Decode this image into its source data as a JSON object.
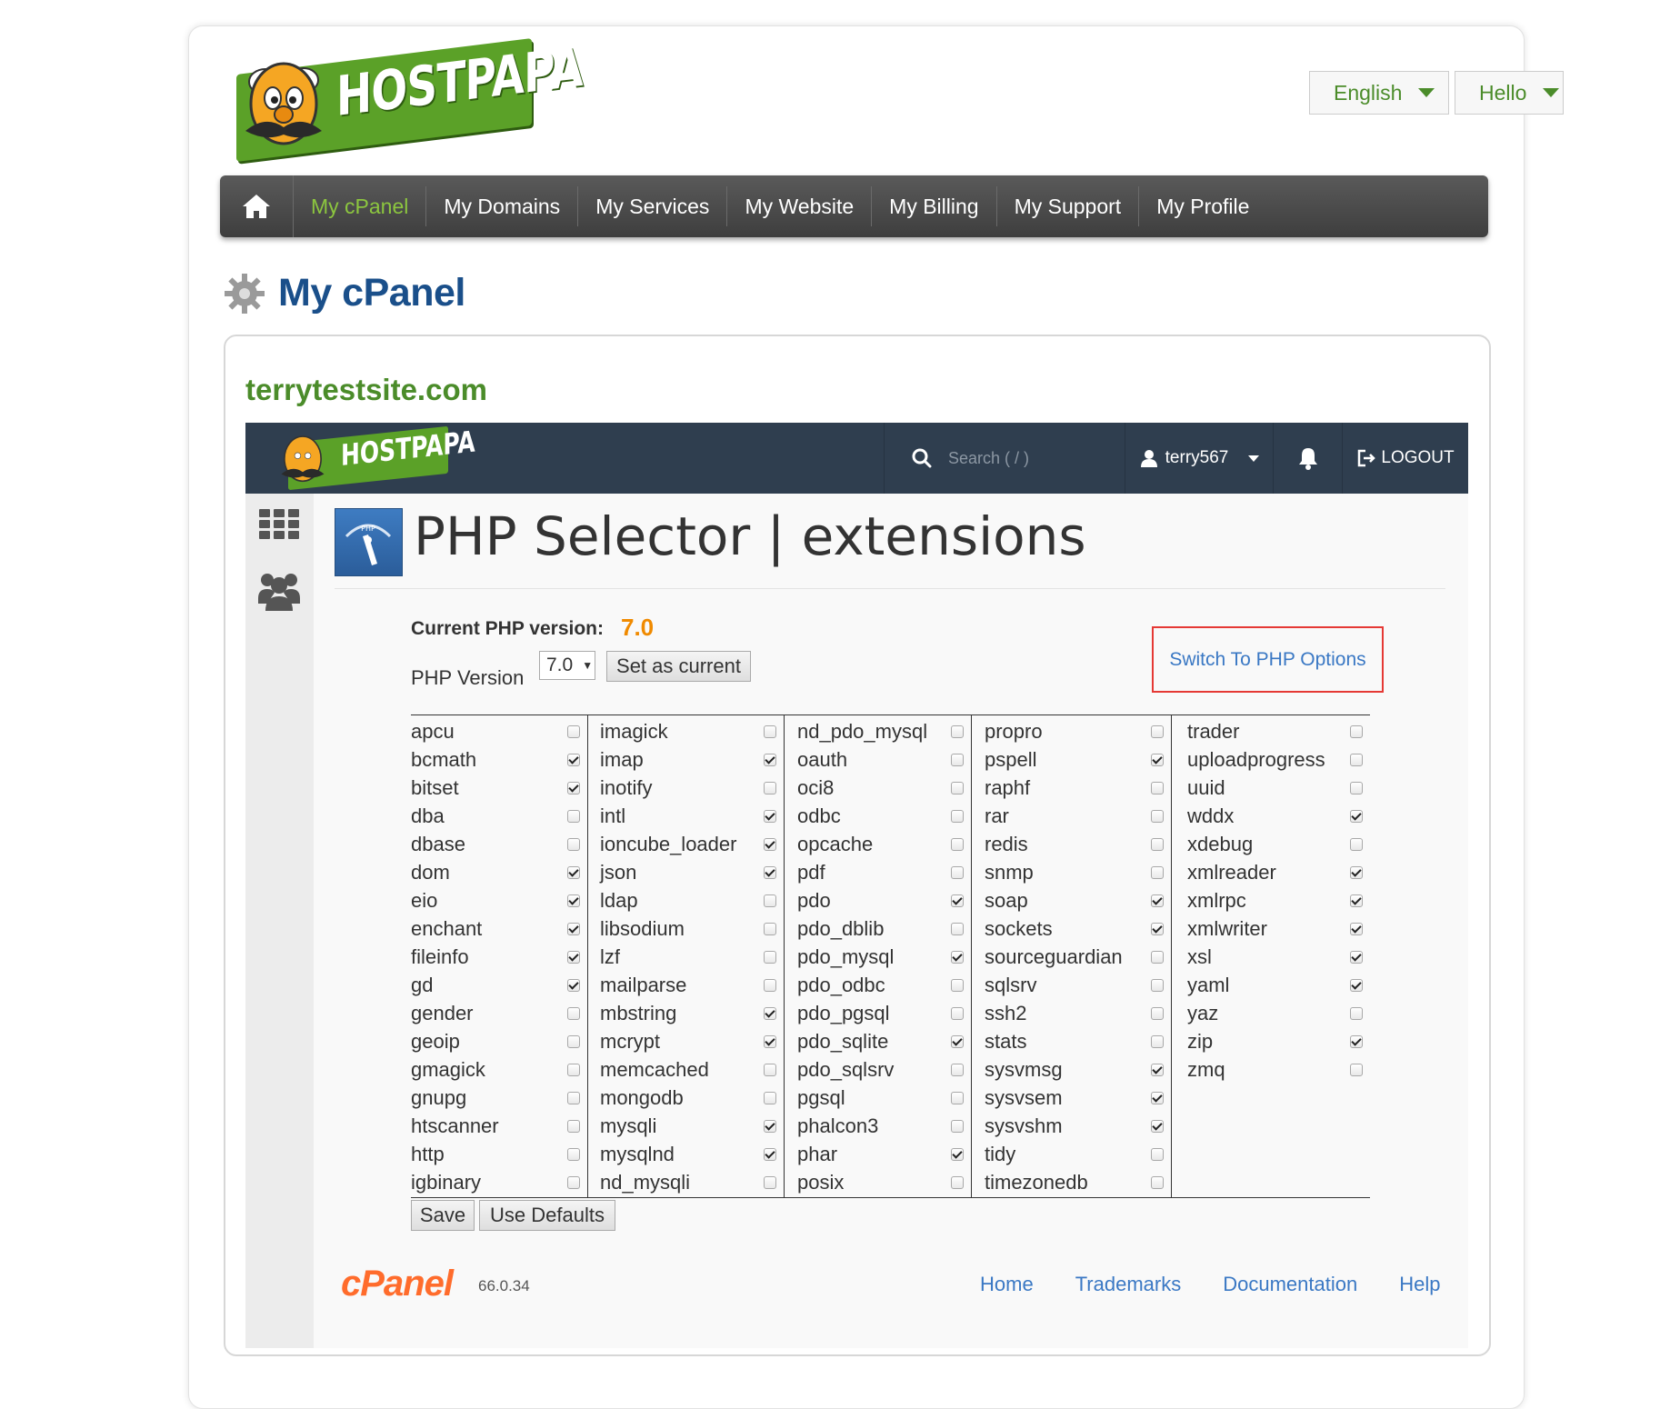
{
  "brand": {
    "logo_text": "HOSTPAPA"
  },
  "top_buttons": {
    "language": "English",
    "hello": "Hello"
  },
  "nav": {
    "items": [
      "My cPanel",
      "My Domains",
      "My Services",
      "My Website",
      "My Billing",
      "My Support",
      "My Profile"
    ],
    "active": "My cPanel"
  },
  "page_title": "My cPanel",
  "site_name": "terrytestsite.com",
  "cpanel": {
    "logo_text": "HOSTPAPA",
    "search_placeholder": "Search ( / )",
    "username": "terry567",
    "logout": "LOGOUT"
  },
  "php_selector": {
    "title": "PHP Selector | extensions",
    "icon_label": "PHP",
    "current_label": "Current PHP version:",
    "current_value": "7.0",
    "version_label": "PHP Version",
    "version_selected": "7.0",
    "set_current": "Set as current",
    "switch_link": "Switch To PHP Options",
    "save": "Save",
    "use_defaults": "Use Defaults"
  },
  "extensions": [
    [
      {
        "name": "apcu",
        "checked": false
      },
      {
        "name": "bcmath",
        "checked": true
      },
      {
        "name": "bitset",
        "checked": true
      },
      {
        "name": "dba",
        "checked": false
      },
      {
        "name": "dbase",
        "checked": false
      },
      {
        "name": "dom",
        "checked": true
      },
      {
        "name": "eio",
        "checked": true
      },
      {
        "name": "enchant",
        "checked": true
      },
      {
        "name": "fileinfo",
        "checked": true
      },
      {
        "name": "gd",
        "checked": true
      },
      {
        "name": "gender",
        "checked": false
      },
      {
        "name": "geoip",
        "checked": false
      },
      {
        "name": "gmagick",
        "checked": false
      },
      {
        "name": "gnupg",
        "checked": false
      },
      {
        "name": "htscanner",
        "checked": false
      },
      {
        "name": "http",
        "checked": false
      },
      {
        "name": "igbinary",
        "checked": false
      }
    ],
    [
      {
        "name": "imagick",
        "checked": false
      },
      {
        "name": "imap",
        "checked": true
      },
      {
        "name": "inotify",
        "checked": false
      },
      {
        "name": "intl",
        "checked": true
      },
      {
        "name": "ioncube_loader",
        "checked": true
      },
      {
        "name": "json",
        "checked": true
      },
      {
        "name": "ldap",
        "checked": false
      },
      {
        "name": "libsodium",
        "checked": false
      },
      {
        "name": "lzf",
        "checked": false
      },
      {
        "name": "mailparse",
        "checked": false
      },
      {
        "name": "mbstring",
        "checked": true
      },
      {
        "name": "mcrypt",
        "checked": true
      },
      {
        "name": "memcached",
        "checked": false
      },
      {
        "name": "mongodb",
        "checked": false
      },
      {
        "name": "mysqli",
        "checked": true
      },
      {
        "name": "mysqlnd",
        "checked": true
      },
      {
        "name": "nd_mysqli",
        "checked": false
      }
    ],
    [
      {
        "name": "nd_pdo_mysql",
        "checked": false
      },
      {
        "name": "oauth",
        "checked": false
      },
      {
        "name": "oci8",
        "checked": false
      },
      {
        "name": "odbc",
        "checked": false
      },
      {
        "name": "opcache",
        "checked": false
      },
      {
        "name": "pdf",
        "checked": false
      },
      {
        "name": "pdo",
        "checked": true
      },
      {
        "name": "pdo_dblib",
        "checked": false
      },
      {
        "name": "pdo_mysql",
        "checked": true
      },
      {
        "name": "pdo_odbc",
        "checked": false
      },
      {
        "name": "pdo_pgsql",
        "checked": false
      },
      {
        "name": "pdo_sqlite",
        "checked": true
      },
      {
        "name": "pdo_sqlsrv",
        "checked": false
      },
      {
        "name": "pgsql",
        "checked": false
      },
      {
        "name": "phalcon3",
        "checked": false
      },
      {
        "name": "phar",
        "checked": true
      },
      {
        "name": "posix",
        "checked": false
      }
    ],
    [
      {
        "name": "propro",
        "checked": false
      },
      {
        "name": "pspell",
        "checked": true
      },
      {
        "name": "raphf",
        "checked": false
      },
      {
        "name": "rar",
        "checked": false
      },
      {
        "name": "redis",
        "checked": false
      },
      {
        "name": "snmp",
        "checked": false
      },
      {
        "name": "soap",
        "checked": true
      },
      {
        "name": "sockets",
        "checked": true
      },
      {
        "name": "sourceguardian",
        "checked": false
      },
      {
        "name": "sqlsrv",
        "checked": false
      },
      {
        "name": "ssh2",
        "checked": false
      },
      {
        "name": "stats",
        "checked": false
      },
      {
        "name": "sysvmsg",
        "checked": true
      },
      {
        "name": "sysvsem",
        "checked": true
      },
      {
        "name": "sysvshm",
        "checked": true
      },
      {
        "name": "tidy",
        "checked": false
      },
      {
        "name": "timezonedb",
        "checked": false
      }
    ],
    [
      {
        "name": "trader",
        "checked": false
      },
      {
        "name": "uploadprogress",
        "checked": false
      },
      {
        "name": "uuid",
        "checked": false
      },
      {
        "name": "wddx",
        "checked": true
      },
      {
        "name": "xdebug",
        "checked": false
      },
      {
        "name": "xmlreader",
        "checked": true
      },
      {
        "name": "xmlrpc",
        "checked": true
      },
      {
        "name": "xmlwriter",
        "checked": true
      },
      {
        "name": "xsl",
        "checked": true
      },
      {
        "name": "yaml",
        "checked": true
      },
      {
        "name": "yaz",
        "checked": false
      },
      {
        "name": "zip",
        "checked": true
      },
      {
        "name": "zmq",
        "checked": false
      }
    ]
  ],
  "footer": {
    "logo_text": "cPanel",
    "version": "66.0.34",
    "links": [
      "Home",
      "Trademarks",
      "Documentation",
      "Help"
    ]
  }
}
